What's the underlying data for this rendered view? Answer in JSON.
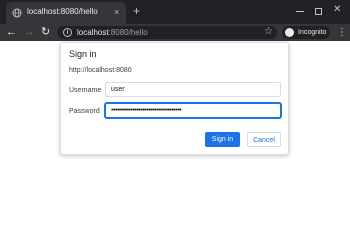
{
  "browser": {
    "tab": {
      "title": "localhost:8080/hello",
      "close": "×"
    },
    "new_tab": "+",
    "window_close": "✕",
    "nav": {
      "back": "←",
      "forward": "→",
      "reload": "↻"
    },
    "address_bar": {
      "host": "localhost",
      "rest": ":8080/hello"
    },
    "star": "☆",
    "incognito": "Incognito",
    "menu": "⋮"
  },
  "dialog": {
    "title": "Sign in",
    "origin": "http://localhost:8080",
    "username_label": "Username",
    "username_value": "user",
    "password_label": "Password",
    "password_value": "••••••••••••••••••••••••••••••••••••",
    "signin_label": "Sign in",
    "cancel_label": "Cancel"
  },
  "colors": {
    "tabstrip": "#202124",
    "toolbar": "#35363a",
    "accent": "#1a73e8"
  },
  "icons": [
    "globe-icon",
    "close-icon",
    "plus-icon",
    "minimize-icon",
    "maximize-icon",
    "back-icon",
    "forward-icon",
    "reload-icon",
    "info-icon",
    "star-icon",
    "incognito-icon",
    "menu-icon"
  ]
}
